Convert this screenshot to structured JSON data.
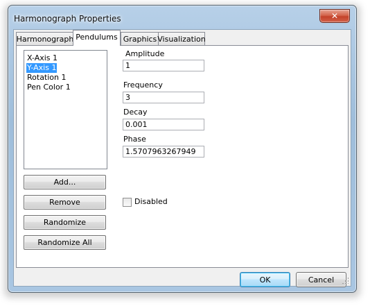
{
  "window": {
    "title": "Harmonograph Properties",
    "close_glyph": "✕"
  },
  "tabs": [
    {
      "label": "Harmonograph",
      "active": false
    },
    {
      "label": "Pendulums",
      "active": true
    },
    {
      "label": "Graphics",
      "active": false
    },
    {
      "label": "Visualization",
      "active": false
    }
  ],
  "pendulums": {
    "items": [
      "X-Axis 1",
      "Y-Axis 1",
      "Rotation 1",
      "Pen Color 1"
    ],
    "selected_index": 1,
    "buttons": {
      "add": "Add...",
      "remove": "Remove",
      "randomize": "Randomize",
      "randomize_all": "Randomize All"
    },
    "fields": {
      "amplitude_label": "Amplitude",
      "amplitude_value": "1",
      "frequency_label": "Frequency",
      "frequency_value": "3",
      "decay_label": "Decay",
      "decay_value": "0.001",
      "phase_label": "Phase",
      "phase_value": "1.5707963267949"
    },
    "disabled_label": "Disabled",
    "disabled_checked": false
  },
  "dialog_buttons": {
    "ok": "OK",
    "cancel": "Cancel"
  }
}
